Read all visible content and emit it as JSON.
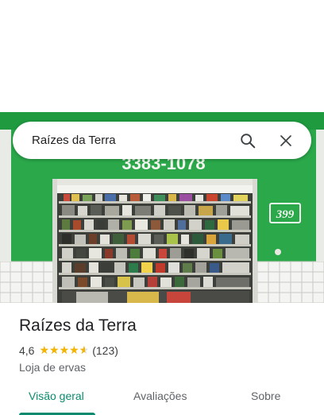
{
  "search": {
    "query": "Raízes da Terra",
    "search_icon": "search-icon",
    "clear_icon": "close-icon"
  },
  "photo": {
    "phone_text": "3383-1078",
    "number_sign": "399",
    "wall_color": "#2aa84a"
  },
  "place": {
    "name": "Raízes da Terra",
    "rating": "4,6",
    "rating_value": 4.6,
    "review_count": "(123)",
    "category": "Loja de ervas"
  },
  "tabs": [
    {
      "label": "Visão geral",
      "active": true
    },
    {
      "label": "Avaliações",
      "active": false
    },
    {
      "label": "Sobre",
      "active": false
    }
  ],
  "colors": {
    "accent": "#0b8a6f",
    "star": "#f4b400"
  }
}
